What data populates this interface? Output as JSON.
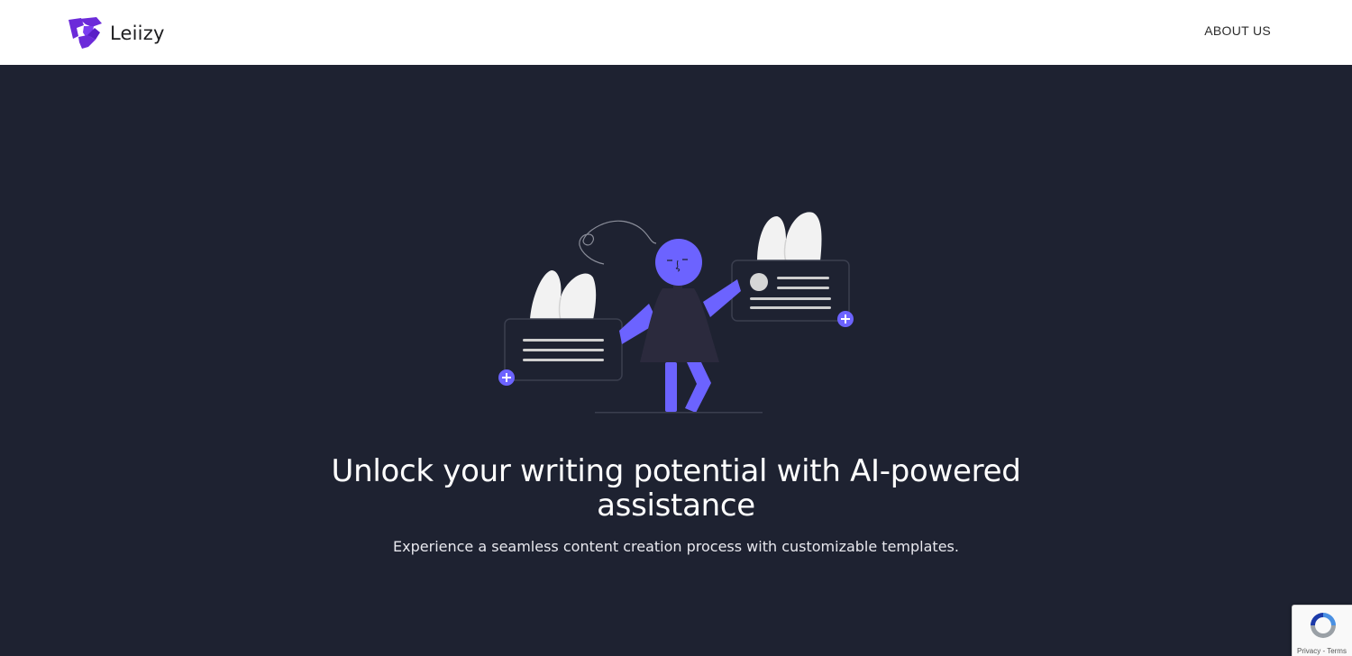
{
  "header": {
    "brand_name": "Leiizy",
    "nav": {
      "about_label": "ABOUT US"
    }
  },
  "hero": {
    "headline": "Unlock your writing potential with AI-powered assistance",
    "subtext": "Experience a seamless content creation process with customizable templates."
  },
  "recaptcha": {
    "links": "Privacy - Terms"
  },
  "colors": {
    "brand": "#6c2bd9",
    "accent": "#6c63ff",
    "hero_bg": "#1e2231",
    "header_bg": "#ffffff"
  },
  "icons": [
    "leiizy-logo-icon",
    "add-icon",
    "recaptcha-icon"
  ]
}
